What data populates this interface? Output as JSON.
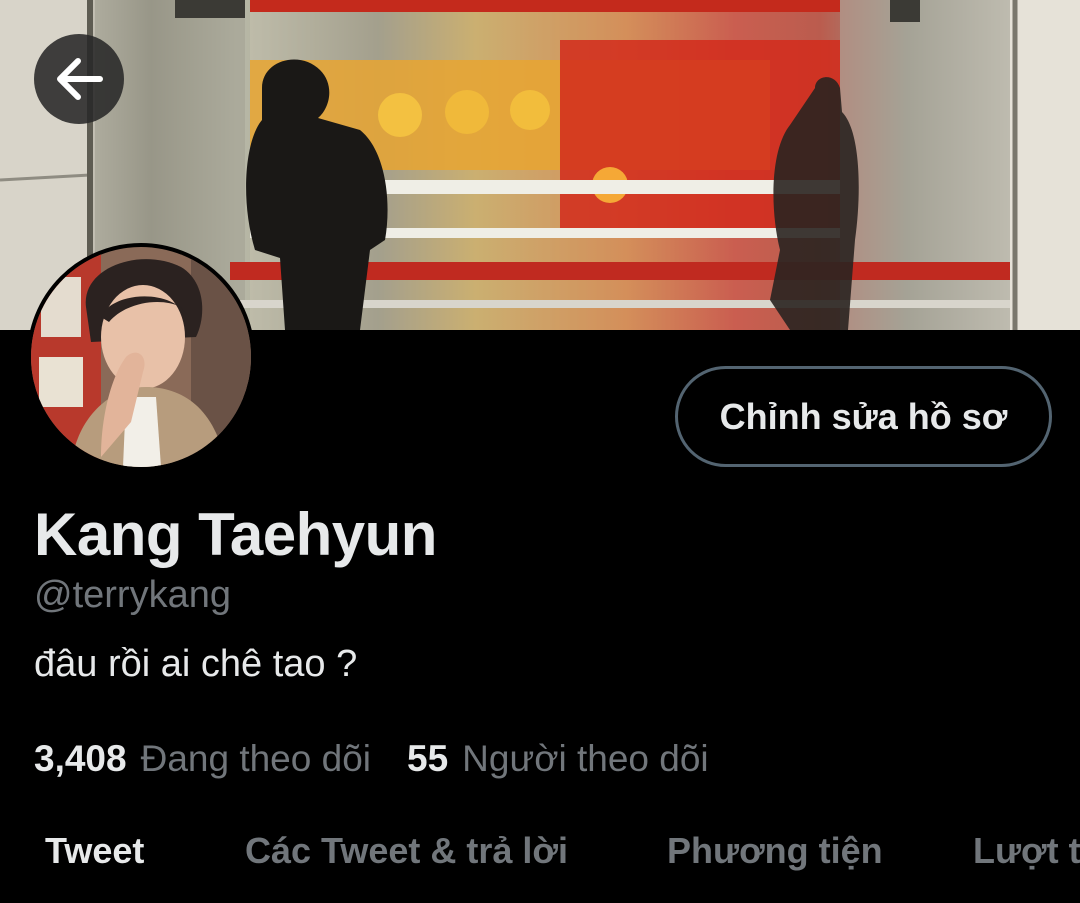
{
  "header": {
    "back_icon": "arrow-left-icon"
  },
  "profile": {
    "display_name": "Kang Taehyun",
    "handle": "@terrykang",
    "bio": "đâu rồi ai chê tao ?",
    "edit_button_label": "Chỉnh sửa hồ sơ"
  },
  "stats": {
    "following_count": "3,408",
    "following_label": "Đang theo dõi",
    "followers_count": "55",
    "followers_label": "Người theo dõi"
  },
  "tabs": [
    {
      "label": "Tweet",
      "active": true
    },
    {
      "label": "Các Tweet & trả lời",
      "active": false
    },
    {
      "label": "Phương tiện",
      "active": false
    },
    {
      "label": "Lượt thích",
      "active": false
    }
  ],
  "colors": {
    "background": "#000000",
    "primary_text": "#e7e9ea",
    "secondary_text": "#71767b",
    "button_border": "#536471"
  }
}
